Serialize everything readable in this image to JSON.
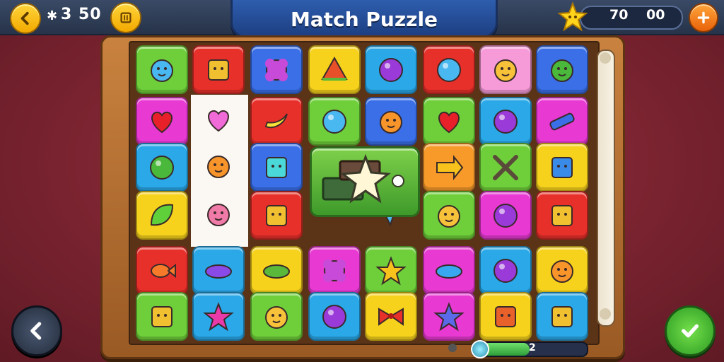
{
  "top_bar": {
    "moves_icon": "✱",
    "moves_text": "3 50",
    "title": "Match Puzzle",
    "score_a": "70",
    "score_b": "00",
    "icons": {
      "back": "chevron-left-icon",
      "pause": "pause-icon",
      "star": "star-icon",
      "add": "plus-icon"
    }
  },
  "board": {
    "columns": 8,
    "rows": 6,
    "tiles": [
      [
        "gem-blue-purple",
        "block-face-yellow",
        "flower-purple",
        "watermelon-slice",
        "balloon-creature",
        "spiky-blue-ball",
        "lemon-yellow",
        "sun-face-green"
      ],
      [
        "heart-red",
        "heart-pink",
        "banana-yellow",
        "button-blue",
        "ginger-figure",
        "heart-red",
        "purple-orb",
        "candy-stick"
      ],
      [
        "spiky-green-ball",
        "blob-orange",
        "cube-teal",
        "treasure-star",
        "treasure-star",
        "arrow-orange",
        "crossed-bones",
        "padlock-blue"
      ],
      [
        "leaf-green",
        "blob-pink",
        "jar-face",
        "treasure-star",
        "ribbon-blue",
        "hat-face",
        "puffball-purple",
        "lantern-face"
      ],
      [
        "fish-orange",
        "jellybean-purple",
        "pickle-green",
        "flower-purple",
        "star-yellow",
        "jellybean-blue",
        "orb-purple",
        "face-orange"
      ],
      [
        "cube-gold",
        "star-pink",
        "cookie-face",
        "orb-purple",
        "bow-red",
        "star-blue",
        "gift-box",
        "drum-stack"
      ]
    ],
    "colors": {
      "green": "#6fcf3a",
      "red": "#e8302a",
      "blue": "#3a6fe8",
      "yellow": "#f7d21c",
      "teal": "#2aa8e8",
      "magenta": "#e83ad2",
      "pink": "#f79ad8",
      "orange": "#f79a2a",
      "purple": "#8a3ae8"
    }
  },
  "progress": {
    "value_label": "2",
    "fraction": 0.5
  },
  "bottom": {
    "back_icon": "chevron-left-icon",
    "confirm_icon": "checkmark-icon"
  }
}
